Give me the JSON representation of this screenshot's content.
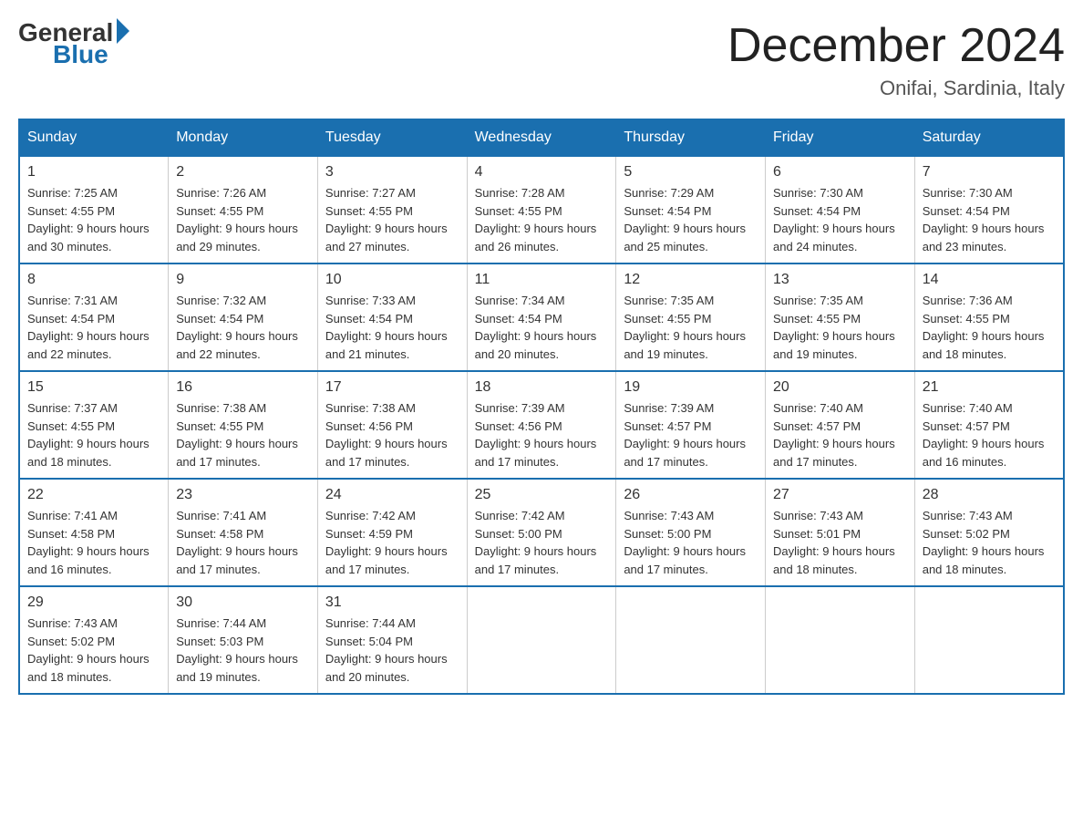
{
  "logo": {
    "general": "General",
    "blue": "Blue"
  },
  "header": {
    "month": "December 2024",
    "location": "Onifai, Sardinia, Italy"
  },
  "days_of_week": [
    "Sunday",
    "Monday",
    "Tuesday",
    "Wednesday",
    "Thursday",
    "Friday",
    "Saturday"
  ],
  "weeks": [
    [
      {
        "num": "1",
        "sunrise": "7:25 AM",
        "sunset": "4:55 PM",
        "daylight": "9 hours and 30 minutes."
      },
      {
        "num": "2",
        "sunrise": "7:26 AM",
        "sunset": "4:55 PM",
        "daylight": "9 hours and 29 minutes."
      },
      {
        "num": "3",
        "sunrise": "7:27 AM",
        "sunset": "4:55 PM",
        "daylight": "9 hours and 27 minutes."
      },
      {
        "num": "4",
        "sunrise": "7:28 AM",
        "sunset": "4:55 PM",
        "daylight": "9 hours and 26 minutes."
      },
      {
        "num": "5",
        "sunrise": "7:29 AM",
        "sunset": "4:54 PM",
        "daylight": "9 hours and 25 minutes."
      },
      {
        "num": "6",
        "sunrise": "7:30 AM",
        "sunset": "4:54 PM",
        "daylight": "9 hours and 24 minutes."
      },
      {
        "num": "7",
        "sunrise": "7:30 AM",
        "sunset": "4:54 PM",
        "daylight": "9 hours and 23 minutes."
      }
    ],
    [
      {
        "num": "8",
        "sunrise": "7:31 AM",
        "sunset": "4:54 PM",
        "daylight": "9 hours and 22 minutes."
      },
      {
        "num": "9",
        "sunrise": "7:32 AM",
        "sunset": "4:54 PM",
        "daylight": "9 hours and 22 minutes."
      },
      {
        "num": "10",
        "sunrise": "7:33 AM",
        "sunset": "4:54 PM",
        "daylight": "9 hours and 21 minutes."
      },
      {
        "num": "11",
        "sunrise": "7:34 AM",
        "sunset": "4:54 PM",
        "daylight": "9 hours and 20 minutes."
      },
      {
        "num": "12",
        "sunrise": "7:35 AM",
        "sunset": "4:55 PM",
        "daylight": "9 hours and 19 minutes."
      },
      {
        "num": "13",
        "sunrise": "7:35 AM",
        "sunset": "4:55 PM",
        "daylight": "9 hours and 19 minutes."
      },
      {
        "num": "14",
        "sunrise": "7:36 AM",
        "sunset": "4:55 PM",
        "daylight": "9 hours and 18 minutes."
      }
    ],
    [
      {
        "num": "15",
        "sunrise": "7:37 AM",
        "sunset": "4:55 PM",
        "daylight": "9 hours and 18 minutes."
      },
      {
        "num": "16",
        "sunrise": "7:38 AM",
        "sunset": "4:55 PM",
        "daylight": "9 hours and 17 minutes."
      },
      {
        "num": "17",
        "sunrise": "7:38 AM",
        "sunset": "4:56 PM",
        "daylight": "9 hours and 17 minutes."
      },
      {
        "num": "18",
        "sunrise": "7:39 AM",
        "sunset": "4:56 PM",
        "daylight": "9 hours and 17 minutes."
      },
      {
        "num": "19",
        "sunrise": "7:39 AM",
        "sunset": "4:57 PM",
        "daylight": "9 hours and 17 minutes."
      },
      {
        "num": "20",
        "sunrise": "7:40 AM",
        "sunset": "4:57 PM",
        "daylight": "9 hours and 17 minutes."
      },
      {
        "num": "21",
        "sunrise": "7:40 AM",
        "sunset": "4:57 PM",
        "daylight": "9 hours and 16 minutes."
      }
    ],
    [
      {
        "num": "22",
        "sunrise": "7:41 AM",
        "sunset": "4:58 PM",
        "daylight": "9 hours and 16 minutes."
      },
      {
        "num": "23",
        "sunrise": "7:41 AM",
        "sunset": "4:58 PM",
        "daylight": "9 hours and 17 minutes."
      },
      {
        "num": "24",
        "sunrise": "7:42 AM",
        "sunset": "4:59 PM",
        "daylight": "9 hours and 17 minutes."
      },
      {
        "num": "25",
        "sunrise": "7:42 AM",
        "sunset": "5:00 PM",
        "daylight": "9 hours and 17 minutes."
      },
      {
        "num": "26",
        "sunrise": "7:43 AM",
        "sunset": "5:00 PM",
        "daylight": "9 hours and 17 minutes."
      },
      {
        "num": "27",
        "sunrise": "7:43 AM",
        "sunset": "5:01 PM",
        "daylight": "9 hours and 18 minutes."
      },
      {
        "num": "28",
        "sunrise": "7:43 AM",
        "sunset": "5:02 PM",
        "daylight": "9 hours and 18 minutes."
      }
    ],
    [
      {
        "num": "29",
        "sunrise": "7:43 AM",
        "sunset": "5:02 PM",
        "daylight": "9 hours and 18 minutes."
      },
      {
        "num": "30",
        "sunrise": "7:44 AM",
        "sunset": "5:03 PM",
        "daylight": "9 hours and 19 minutes."
      },
      {
        "num": "31",
        "sunrise": "7:44 AM",
        "sunset": "5:04 PM",
        "daylight": "9 hours and 20 minutes."
      },
      null,
      null,
      null,
      null
    ]
  ],
  "colors": {
    "header_bg": "#1a6faf",
    "header_text": "#ffffff",
    "border": "#1a6faf",
    "row_border": "#1a6faf"
  }
}
